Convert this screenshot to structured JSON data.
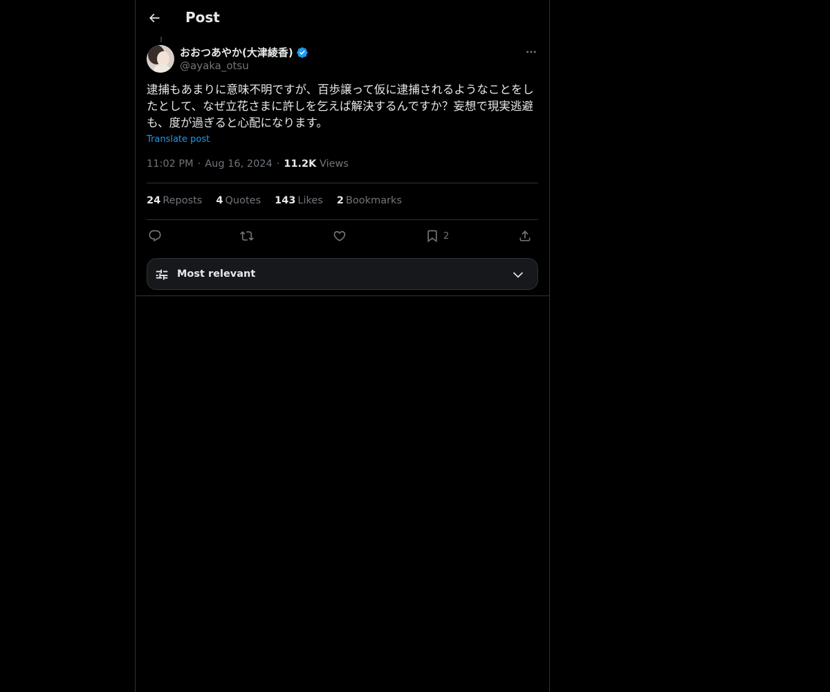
{
  "header": {
    "title": "Post"
  },
  "author": {
    "name": "おおつあやか(大津綾香)",
    "handle": "@ayaka_otsu"
  },
  "post": {
    "text": "逮捕もあまりに意味不明ですが、百歩譲って仮に逮捕されるようなことをしたとして、なぜ立花さまに許しを乞えば解決するんですか？妄想で現実逃避も、度が過ぎると心配になります。",
    "translate_label": "Translate post",
    "time": "11:02 PM",
    "date": "Aug 16, 2024",
    "views_count": "11.2K",
    "views_label": "Views",
    "separator": "·"
  },
  "stats": {
    "reposts_count": "24",
    "reposts_label": "Reposts",
    "quotes_count": "4",
    "quotes_label": "Quotes",
    "likes_count": "143",
    "likes_label": "Likes",
    "bookmarks_count": "2",
    "bookmarks_label": "Bookmarks"
  },
  "actions": {
    "reply_icon": "reply-icon",
    "repost_icon": "repost-icon",
    "like_icon": "heart-icon",
    "bookmark_icon": "bookmark-icon",
    "bookmark_count": "2",
    "share_icon": "share-icon"
  },
  "sort": {
    "label": "Most relevant"
  },
  "colors": {
    "background": "#000000",
    "text": "#e7e9ea",
    "muted": "#71767b",
    "accent": "#1d9bf0",
    "border": "#2f3336"
  }
}
